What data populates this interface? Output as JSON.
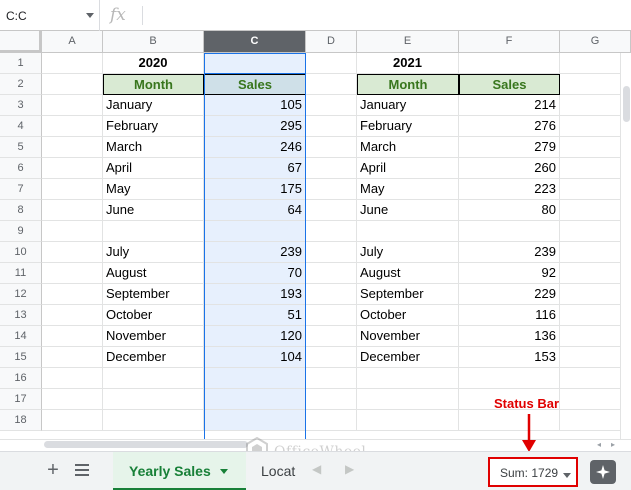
{
  "formula_bar": {
    "name_box": "C:C",
    "fx_symbol": "fx",
    "formula": ""
  },
  "columns": [
    "A",
    "B",
    "C",
    "D",
    "E",
    "F",
    "G"
  ],
  "selected_column": "C",
  "rows": [
    "1",
    "2",
    "3",
    "4",
    "5",
    "6",
    "7",
    "8",
    "9",
    "10",
    "11",
    "12",
    "13",
    "14",
    "15",
    "16",
    "17",
    "18"
  ],
  "table_2020": {
    "year": "2020",
    "header": [
      "Month",
      "Sales"
    ],
    "rows": [
      [
        "January",
        "105"
      ],
      [
        "February",
        "295"
      ],
      [
        "March",
        "246"
      ],
      [
        "April",
        "67"
      ],
      [
        "May",
        "175"
      ],
      [
        "June",
        "64"
      ],
      [
        "",
        ""
      ],
      [
        "July",
        "239"
      ],
      [
        "August",
        "70"
      ],
      [
        "September",
        "193"
      ],
      [
        "October",
        "51"
      ],
      [
        "November",
        "120"
      ],
      [
        "December",
        "104"
      ]
    ]
  },
  "table_2021": {
    "year": "2021",
    "header": [
      "Month",
      "Sales"
    ],
    "rows": [
      [
        "January",
        "214"
      ],
      [
        "February",
        "276"
      ],
      [
        "March",
        "279"
      ],
      [
        "April",
        "260"
      ],
      [
        "May",
        "223"
      ],
      [
        "June",
        "80"
      ],
      [
        "",
        ""
      ],
      [
        "July",
        "239"
      ],
      [
        "August",
        "92"
      ],
      [
        "September",
        "229"
      ],
      [
        "October",
        "116"
      ],
      [
        "November",
        "136"
      ],
      [
        "December",
        "153"
      ]
    ]
  },
  "sheet_tabs": {
    "active": "Yearly Sales",
    "second": "Locat"
  },
  "status_bar": {
    "sum": "Sum: 1729"
  },
  "annotation": {
    "label": "Status Bar"
  },
  "watermark": {
    "text": "OfficeWheel"
  },
  "colors": {
    "header_fill": "#d9ead3",
    "header_text": "#38761d",
    "selection": "#1a73e8",
    "active_tab": "#188038",
    "annotation": "#e00000"
  }
}
